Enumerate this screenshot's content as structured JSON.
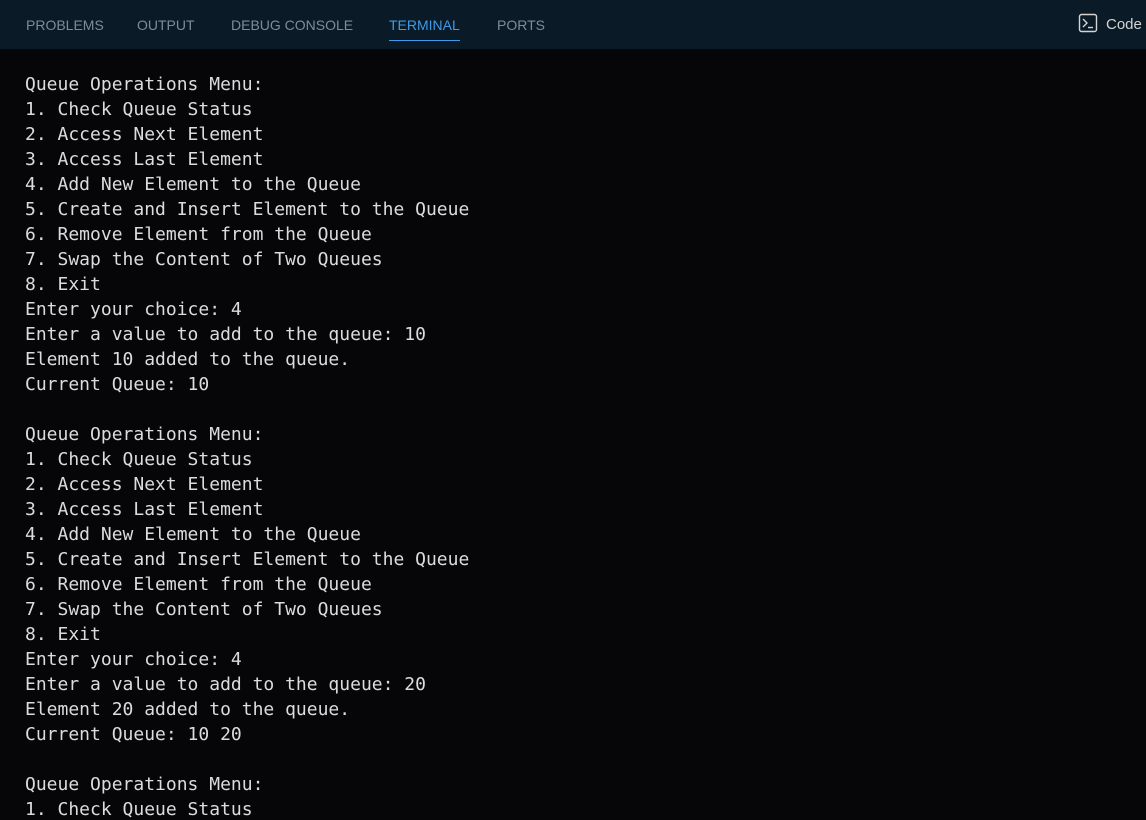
{
  "panel": {
    "tabs": [
      {
        "label": "PROBLEMS"
      },
      {
        "label": "OUTPUT"
      },
      {
        "label": "DEBUG CONSOLE"
      },
      {
        "label": "TERMINAL"
      },
      {
        "label": "PORTS"
      }
    ],
    "active_tab": "TERMINAL",
    "terminal_label": "Code",
    "icons": {
      "terminal": "terminal-icon"
    }
  },
  "colors": {
    "tabbar_bg": "#0a1a27",
    "terminal_bg": "#060608",
    "active_tab": "#3e9be9",
    "inactive_tab": "#7d8c99",
    "terminal_text": "#dcdcdc"
  },
  "terminal": {
    "lines": [
      "Queue Operations Menu:",
      "1. Check Queue Status",
      "2. Access Next Element",
      "3. Access Last Element",
      "4. Add New Element to the Queue",
      "5. Create and Insert Element to the Queue",
      "6. Remove Element from the Queue",
      "7. Swap the Content of Two Queues",
      "8. Exit",
      "Enter your choice: 4",
      "Enter a value to add to the queue: 10",
      "Element 10 added to the queue.",
      "Current Queue: 10",
      "",
      "Queue Operations Menu:",
      "1. Check Queue Status",
      "2. Access Next Element",
      "3. Access Last Element",
      "4. Add New Element to the Queue",
      "5. Create and Insert Element to the Queue",
      "6. Remove Element from the Queue",
      "7. Swap the Content of Two Queues",
      "8. Exit",
      "Enter your choice: 4",
      "Enter a value to add to the queue: 20",
      "Element 20 added to the queue.",
      "Current Queue: 10 20",
      "",
      "Queue Operations Menu:",
      "1. Check Queue Status"
    ]
  }
}
